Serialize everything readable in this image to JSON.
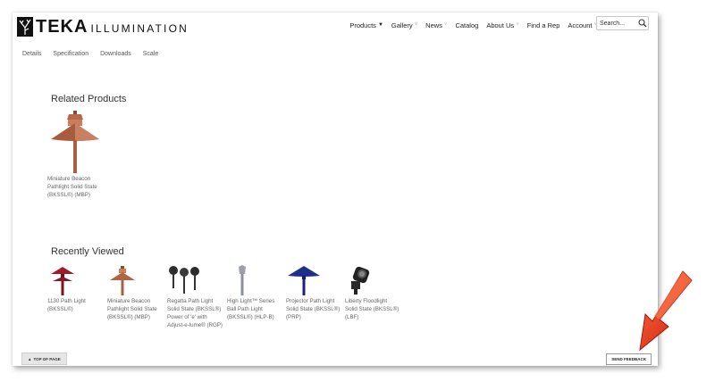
{
  "brand": {
    "name": "TEKA",
    "tagline": "ILLUMINATION"
  },
  "nav": {
    "items": [
      {
        "label": "Products",
        "caret": "▼",
        "caret_style": "dark"
      },
      {
        "label": "Gallery",
        "caret": "˅",
        "caret_style": "light"
      },
      {
        "label": "News",
        "caret": "˅",
        "caret_style": "light"
      },
      {
        "label": "Catalog",
        "caret": "",
        "caret_style": "none"
      },
      {
        "label": "About Us",
        "caret": "˅",
        "caret_style": "light"
      },
      {
        "label": "Find a Rep",
        "caret": "",
        "caret_style": "none"
      },
      {
        "label": "Account",
        "caret": "˅",
        "caret_style": "light"
      }
    ],
    "search_placeholder": "Search..."
  },
  "subnav": [
    "Details",
    "Specification",
    "Downloads",
    "Scale"
  ],
  "related": {
    "title": "Related Products",
    "items": [
      {
        "name": "Miniature Beacon Pathlight Solid State (BKSSL®) (MBP)",
        "icon": "copper-beacon-pathlight"
      }
    ]
  },
  "recent": {
    "title": "Recently Viewed",
    "items": [
      {
        "name": "1130 Path Light (BKSSL®)",
        "icon": "red-tiered-path-light"
      },
      {
        "name": "Miniature Beacon Pathlight Solid State (BKSSL®) (MBP)",
        "icon": "copper-beacon-pathlight"
      },
      {
        "name": "Regatta Path Light Solid State (BKSSL®) Power of 'e' with Adjust-e-lume® (RGP)",
        "icon": "dark-regatta-path-lights"
      },
      {
        "name": "High Light™ Series Ball Path Light (BKSSL®) (HLP-B)",
        "icon": "silver-spike-path-light"
      },
      {
        "name": "Projector Path Light Solid State (BKSSL®) (PRP)",
        "icon": "blue-projector-path-light"
      },
      {
        "name": "Liberty Floodlight Solid State (BKSSL®) (LBF)",
        "icon": "black-flood-light"
      }
    ]
  },
  "footer": {
    "top_label": "TOP OF PAGE",
    "top_arrow": "▲",
    "feedback_label": "SEND FEEDBACK"
  },
  "colors": {
    "copper": "#b5694a",
    "red": "#9e1b2c",
    "blue": "#1f2f8c",
    "arrow": "#e8341c"
  }
}
